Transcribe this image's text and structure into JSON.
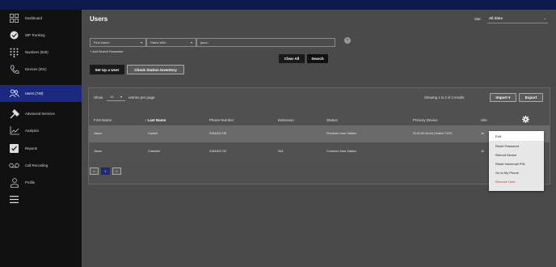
{
  "sidebar": {
    "items": [
      {
        "label": "Dashboard",
        "icon": "grid-icon"
      },
      {
        "label": "SIP Trunking",
        "icon": "cloud-icon"
      },
      {
        "label": "Numbers (925)",
        "icon": "dialpad-icon"
      },
      {
        "label": "Devices (301)",
        "icon": "phone-icon"
      },
      {
        "label": "Users (740)",
        "icon": "users-icon"
      },
      {
        "label": "Advanced Services",
        "icon": "tools-icon"
      },
      {
        "label": "Analytics",
        "icon": "chart-icon"
      },
      {
        "label": "Reports",
        "icon": "check-icon"
      },
      {
        "label": "Call Recording",
        "icon": "voicemail-icon"
      },
      {
        "label": "Profile",
        "icon": "person-icon"
      },
      {
        "label": "",
        "icon": "menu-icon"
      }
    ]
  },
  "header": {
    "title": "Users",
    "site_label": "Site:",
    "site_value": "All Sites"
  },
  "search": {
    "field": "First Name",
    "operator": "Starts With",
    "value": "jason",
    "add_param": "+ Add Search Parameter",
    "clear_label": "Clear All",
    "search_label": "Search"
  },
  "actions": {
    "setup_user": "Set Up a User",
    "check_inventory": "Check Station Inventory"
  },
  "table": {
    "show_label": "Show",
    "page_size": "10",
    "entries_label": "entries per page",
    "showing": "Showing 1 to 2 of 2 results",
    "import_label": "Import",
    "export_label": "Export",
    "columns": [
      "First Name",
      "↑ Last Name",
      "Phone Number",
      "Extension",
      "Station",
      "Primary Device",
      "Site"
    ],
    "rows": [
      {
        "first": "Jason",
        "last": "Cantell",
        "phone": "9164401745",
        "ext": "",
        "station": "Premium User Station",
        "device": "00:04:0E:4A:AA (Yealink T41P)",
        "site": "Je"
      },
      {
        "first": "Jason",
        "last": "Chandler",
        "phone": "9164401732",
        "ext": "343",
        "station": "Common Area Station",
        "device": "",
        "site": "Je"
      }
    ]
  },
  "pagination": {
    "prev": "«",
    "current": "1",
    "next": "»"
  },
  "context_menu": {
    "items": [
      "Edit",
      "Reset Password",
      "Reboot Device",
      "Reset Voicemail PIN",
      "Go to My Phone",
      "Remove User"
    ],
    "danger_color": "#d0342c"
  },
  "colors": {
    "active_nav": "#1b2a80",
    "topbar": "#0b1a4a"
  }
}
